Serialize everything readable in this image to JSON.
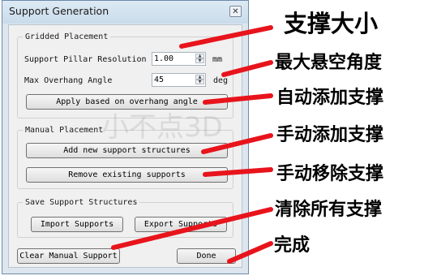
{
  "window": {
    "title": "Support Generation",
    "close_icon": "close-icon"
  },
  "gridded": {
    "group_label": "Gridded Placement",
    "resolution_label": "Support Pillar Resolution",
    "resolution_value": "1.00",
    "resolution_unit": "mm",
    "overhang_label": "Max Overhang Angle",
    "overhang_value": "45",
    "overhang_unit": "deg",
    "apply_button": "Apply based on overhang angle"
  },
  "manual": {
    "group_label": "Manual Placement",
    "add_button": "Add new support structures",
    "remove_button": "Remove existing supports"
  },
  "save": {
    "group_label": "Save Support Structures",
    "import_button": "Import Supports",
    "export_button": "Export Supports"
  },
  "footer": {
    "clear_button": "Clear Manual Support",
    "done_button": "Done"
  },
  "watermark": "小不点3D",
  "annotations": {
    "resolution": "支撑大小",
    "overhang": "最大悬空角度",
    "apply": "自动添加支撑",
    "add": "手动添加支撑",
    "remove": "手动移除支撑",
    "clear": "清除所有支撑",
    "done": "完成",
    "arrow_color": "#e8141c"
  }
}
